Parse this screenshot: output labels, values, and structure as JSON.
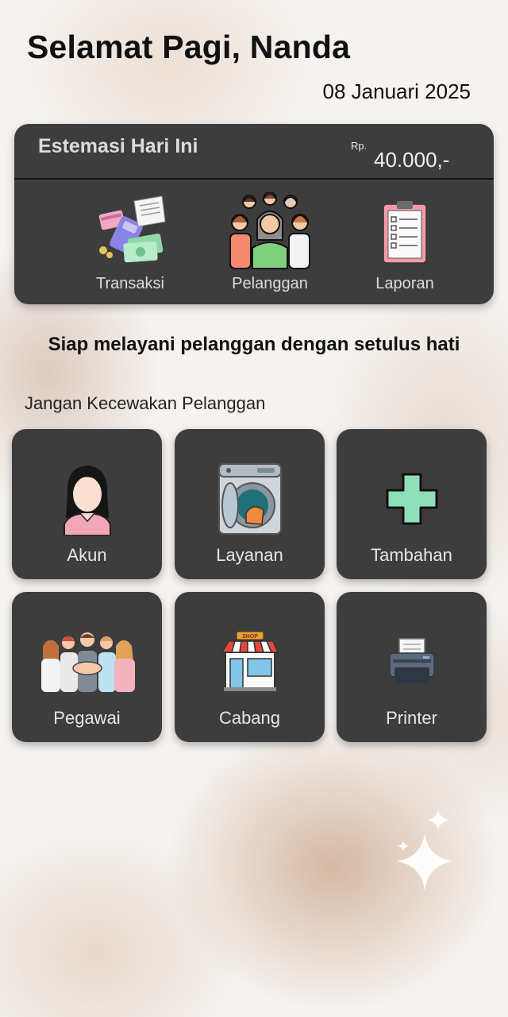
{
  "header": {
    "greeting": "Selamat Pagi, Nanda",
    "date": "08 Januari 2025"
  },
  "summary_card": {
    "title": "Estemasi Hari Ini",
    "currency": "Rp.",
    "amount": "40.000,-",
    "items": [
      {
        "label": "Transaksi",
        "icon": "transaction-icon"
      },
      {
        "label": "Pelanggan",
        "icon": "customers-icon"
      },
      {
        "label": "Laporan",
        "icon": "report-icon"
      }
    ]
  },
  "tagline": "Siap melayani pelanggan dengan setulus hati",
  "subtitle": "Jangan Kecewakan Pelanggan",
  "menu": [
    {
      "label": "Akun",
      "icon": "account-icon"
    },
    {
      "label": "Layanan",
      "icon": "washing-machine-icon"
    },
    {
      "label": "Tambahan",
      "icon": "plus-icon"
    },
    {
      "label": "Pegawai",
      "icon": "employees-icon"
    },
    {
      "label": "Cabang",
      "icon": "shop-icon"
    },
    {
      "label": "Printer",
      "icon": "printer-icon"
    }
  ],
  "shop_sign": "SHOP",
  "colors": {
    "card_bg": "#3e3d3d",
    "plus_icon": "#8fe0b8"
  }
}
